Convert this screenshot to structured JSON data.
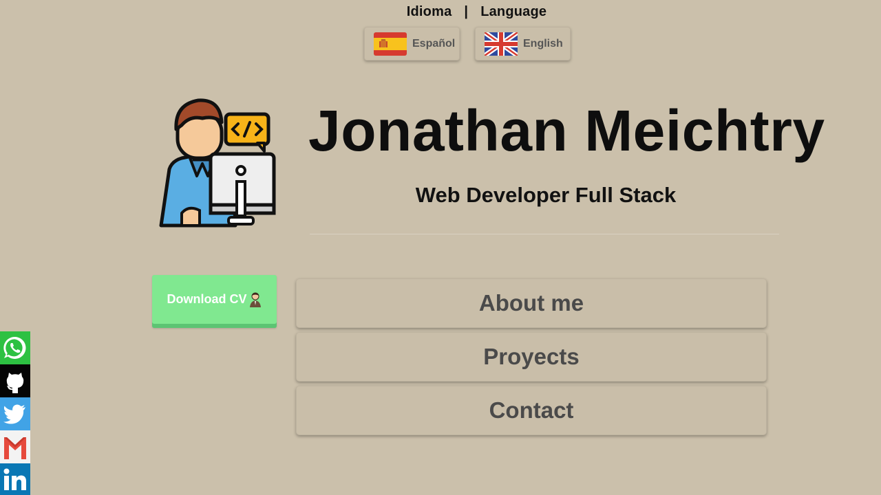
{
  "language_header": {
    "idioma": "Idioma",
    "separator": "|",
    "language": "Language"
  },
  "language_buttons": {
    "spanish": "Español",
    "english": "English"
  },
  "hero": {
    "name": "Jonathan Meichtry",
    "subtitle": "Web Developer Full Stack",
    "avatar_icon": "developer-at-computer-icon"
  },
  "download": {
    "label": "Download CV",
    "icon": "person-icon"
  },
  "nav": {
    "about": "About me",
    "projects": "Proyects",
    "contact": "Contact"
  },
  "social": [
    "whatsapp-icon",
    "github-icon",
    "twitter-icon",
    "gmail-icon",
    "linkedin-icon"
  ],
  "colors": {
    "background": "#cbc0ab",
    "download_button": "#80e890",
    "whatsapp": "#2dc142",
    "github": "#050505",
    "twitter": "#41a3e6",
    "gmail": "#f3f3f3",
    "linkedin": "#0a77b4"
  }
}
